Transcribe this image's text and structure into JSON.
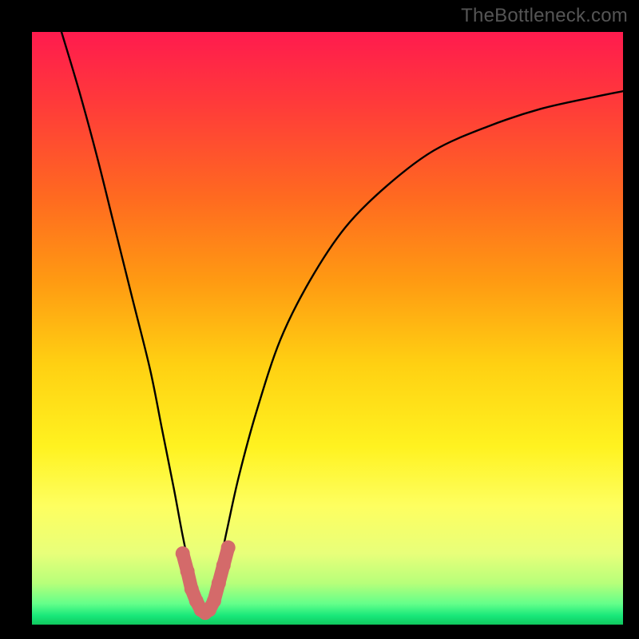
{
  "watermark": "TheBottleneck.com",
  "gradient": {
    "stops": [
      {
        "offset": 0.0,
        "color": "#ff1b4e"
      },
      {
        "offset": 0.12,
        "color": "#ff3a3a"
      },
      {
        "offset": 0.28,
        "color": "#ff6a20"
      },
      {
        "offset": 0.42,
        "color": "#ff9a12"
      },
      {
        "offset": 0.56,
        "color": "#ffd012"
      },
      {
        "offset": 0.7,
        "color": "#fff220"
      },
      {
        "offset": 0.8,
        "color": "#feff60"
      },
      {
        "offset": 0.88,
        "color": "#e8ff7a"
      },
      {
        "offset": 0.93,
        "color": "#b7ff7a"
      },
      {
        "offset": 0.965,
        "color": "#63ff8a"
      },
      {
        "offset": 0.985,
        "color": "#18e87a"
      },
      {
        "offset": 1.0,
        "color": "#10c95e"
      }
    ]
  },
  "chart_data": {
    "type": "line",
    "title": "",
    "xlabel": "",
    "ylabel": "",
    "xlim": [
      0,
      100
    ],
    "ylim": [
      0,
      100
    ],
    "series": [
      {
        "name": "curve",
        "x": [
          5,
          8,
          11,
          14,
          17,
          20,
          22,
          24,
          25.5,
          27,
          28,
          29,
          30,
          31.5,
          33,
          35,
          38,
          42,
          47,
          53,
          60,
          68,
          77,
          86,
          95,
          100
        ],
        "y": [
          100,
          90,
          79,
          67,
          55,
          43,
          33,
          23,
          15,
          8,
          4,
          2,
          4,
          9,
          16,
          25,
          36,
          48,
          58,
          67,
          74,
          80,
          84,
          87,
          89,
          90
        ]
      }
    ],
    "marker_cluster": {
      "name": "bottom-cluster",
      "color": "#d46a6a",
      "points": [
        {
          "x": 25.5,
          "y": 12
        },
        {
          "x": 26.3,
          "y": 9
        },
        {
          "x": 27.0,
          "y": 6
        },
        {
          "x": 27.8,
          "y": 4
        },
        {
          "x": 28.6,
          "y": 2.5
        },
        {
          "x": 29.3,
          "y": 2
        },
        {
          "x": 30.0,
          "y": 2.5
        },
        {
          "x": 30.8,
          "y": 4
        },
        {
          "x": 31.6,
          "y": 7
        },
        {
          "x": 32.4,
          "y": 10
        },
        {
          "x": 33.2,
          "y": 13
        }
      ]
    }
  }
}
